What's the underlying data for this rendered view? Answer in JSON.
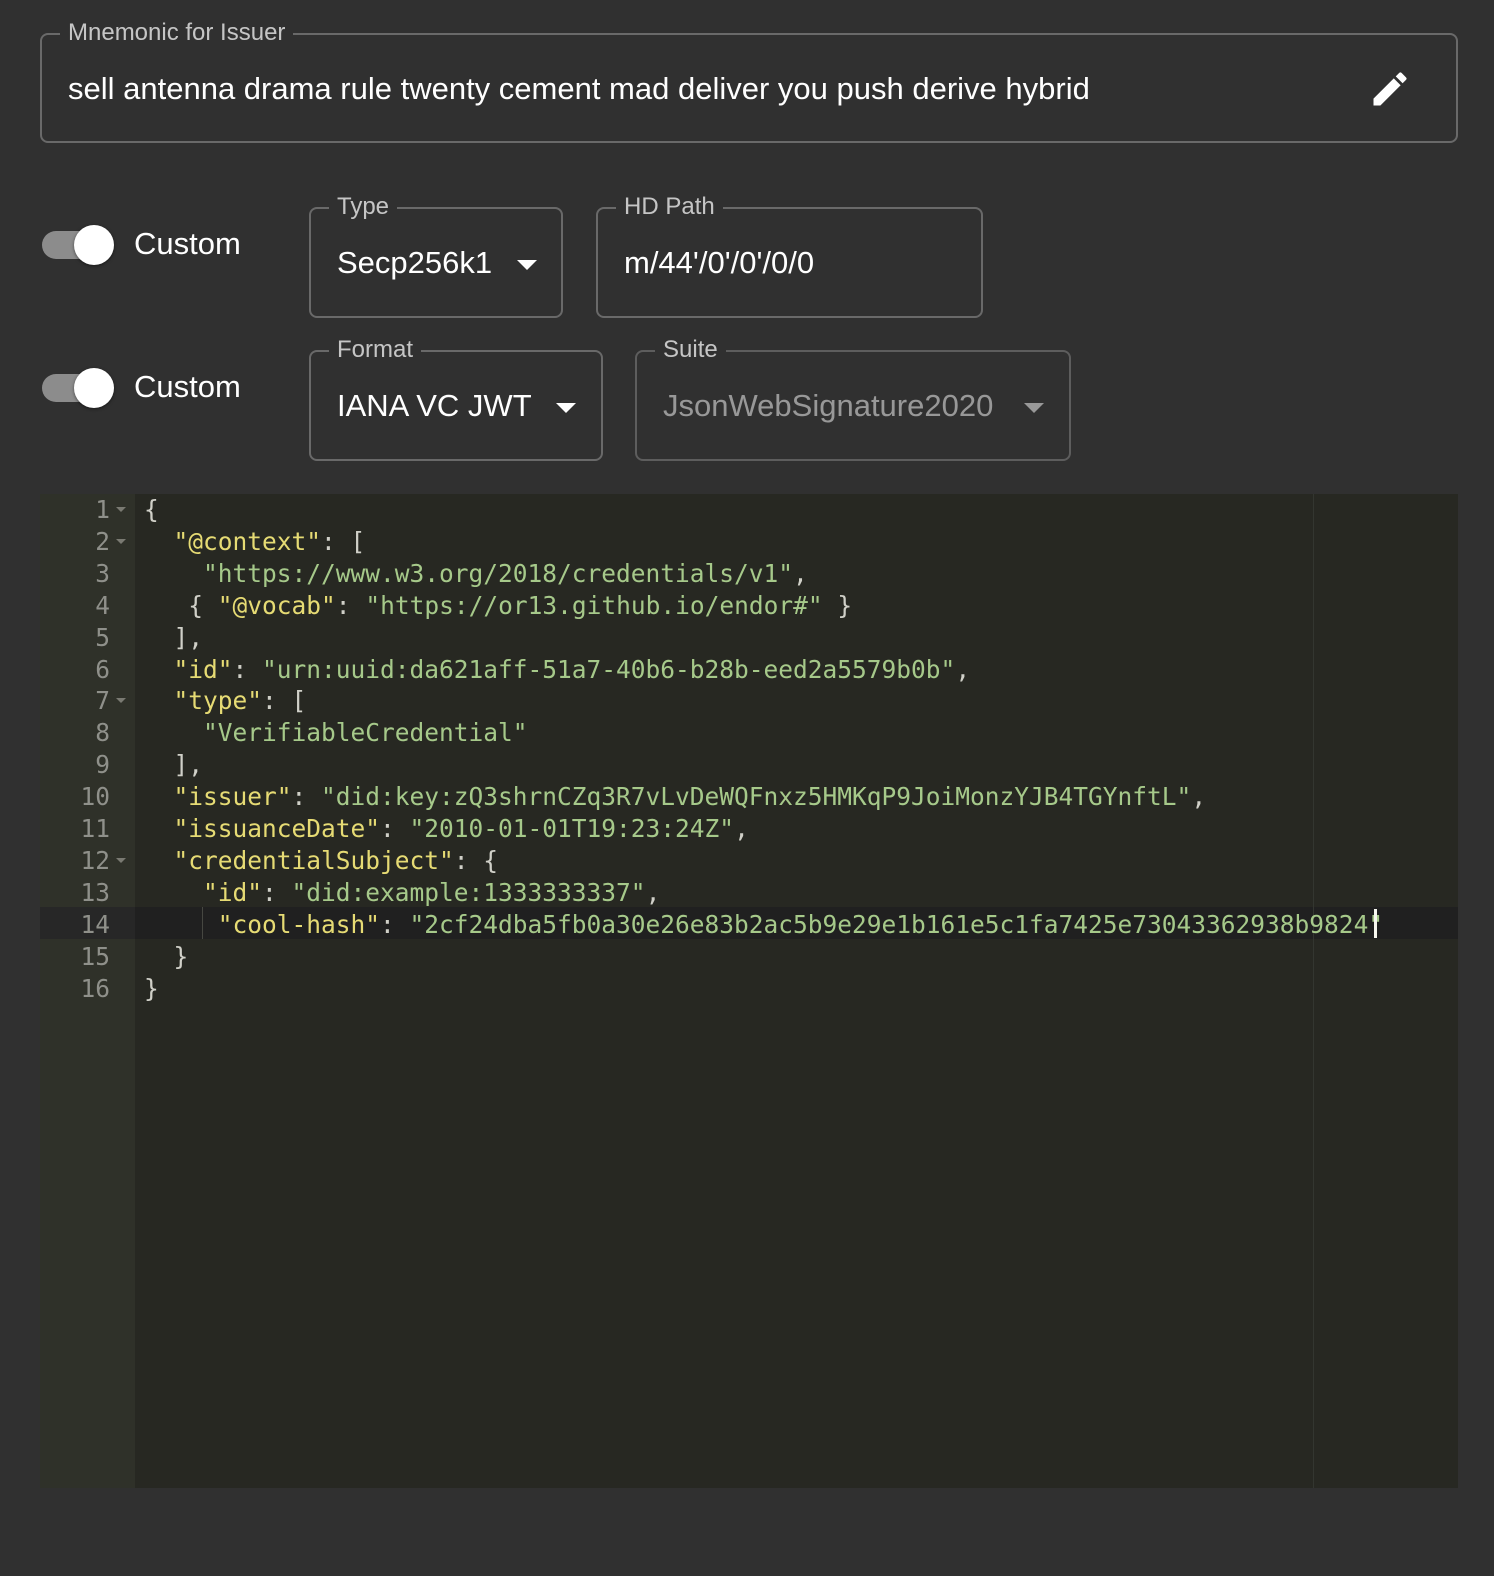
{
  "mnemonic": {
    "label": "Mnemonic for Issuer",
    "value": "sell antenna drama rule twenty cement mad deliver you push derive hybrid",
    "edit_icon": "pencil-icon"
  },
  "key_row": {
    "switch_label": "Custom",
    "switch_on": true,
    "type": {
      "label": "Type",
      "value": "Secp256k1"
    },
    "hd_path": {
      "label": "HD Path",
      "value": "m/44'/0'/0'/0/0"
    }
  },
  "format_row": {
    "switch_label": "Custom",
    "switch_on": true,
    "format": {
      "label": "Format",
      "value": "IANA VC JWT"
    },
    "suite": {
      "label": "Suite",
      "value": "JsonWebSignature2020",
      "disabled": true
    }
  },
  "editor": {
    "active_line": 14,
    "lines": [
      {
        "n": "1",
        "fold": true,
        "indent": "",
        "parts": [
          [
            "p",
            "{"
          ]
        ]
      },
      {
        "n": "2",
        "fold": true,
        "indent": "  ",
        "parts": [
          [
            "k",
            "\"@context\""
          ],
          [
            "p",
            ": ["
          ]
        ]
      },
      {
        "n": "3",
        "fold": false,
        "indent": "    ",
        "parts": [
          [
            "s",
            "\"https://www.w3.org/2018/credentials/v1\""
          ],
          [
            "p",
            ","
          ]
        ]
      },
      {
        "n": "4",
        "fold": false,
        "indent": "   ",
        "parts": [
          [
            "p",
            "{ "
          ],
          [
            "k",
            "\"@vocab\""
          ],
          [
            "p",
            ": "
          ],
          [
            "s",
            "\"https://or13.github.io/endor#\""
          ],
          [
            "p",
            " }"
          ]
        ]
      },
      {
        "n": "5",
        "fold": false,
        "indent": "  ",
        "parts": [
          [
            "p",
            "],"
          ]
        ]
      },
      {
        "n": "6",
        "fold": false,
        "indent": "  ",
        "parts": [
          [
            "k",
            "\"id\""
          ],
          [
            "p",
            ": "
          ],
          [
            "s",
            "\"urn:uuid:da621aff-51a7-40b6-b28b-eed2a5579b0b\""
          ],
          [
            "p",
            ","
          ]
        ]
      },
      {
        "n": "7",
        "fold": true,
        "indent": "  ",
        "parts": [
          [
            "k",
            "\"type\""
          ],
          [
            "p",
            ": ["
          ]
        ]
      },
      {
        "n": "8",
        "fold": false,
        "indent": "    ",
        "parts": [
          [
            "s",
            "\"VerifiableCredential\""
          ]
        ]
      },
      {
        "n": "9",
        "fold": false,
        "indent": "  ",
        "parts": [
          [
            "p",
            "],"
          ]
        ]
      },
      {
        "n": "10",
        "fold": false,
        "indent": "  ",
        "parts": [
          [
            "k",
            "\"issuer\""
          ],
          [
            "p",
            ": "
          ],
          [
            "s",
            "\"did:key:zQ3shrnCZq3R7vLvDeWQFnxz5HMKqP9JoiMonzYJB4TGYnftL\""
          ],
          [
            "p",
            ","
          ]
        ]
      },
      {
        "n": "11",
        "fold": false,
        "indent": "  ",
        "parts": [
          [
            "k",
            "\"issuanceDate\""
          ],
          [
            "p",
            ": "
          ],
          [
            "s",
            "\"2010-01-01T19:23:24Z\""
          ],
          [
            "p",
            ","
          ]
        ]
      },
      {
        "n": "12",
        "fold": true,
        "indent": "  ",
        "parts": [
          [
            "k",
            "\"credentialSubject\""
          ],
          [
            "p",
            ": {"
          ]
        ]
      },
      {
        "n": "13",
        "fold": false,
        "indent": "    ",
        "parts": [
          [
            "k",
            "\"id\""
          ],
          [
            "p",
            ": "
          ],
          [
            "s",
            "\"did:example:1333333337\""
          ],
          [
            "p",
            ","
          ]
        ]
      },
      {
        "n": "14",
        "fold": false,
        "indent": "     ",
        "parts": [
          [
            "k",
            "\"cool-hash\""
          ],
          [
            "p",
            ": "
          ],
          [
            "s",
            "\"2cf24dba5fb0a30e26e83b2ac5b9e29e1b161e5c1fa7425e73043362938b9824\""
          ]
        ]
      },
      {
        "n": "15",
        "fold": false,
        "indent": "  ",
        "parts": [
          [
            "p",
            "}"
          ]
        ]
      },
      {
        "n": "16",
        "fold": false,
        "indent": "",
        "parts": [
          [
            "p",
            "}"
          ]
        ]
      }
    ]
  }
}
